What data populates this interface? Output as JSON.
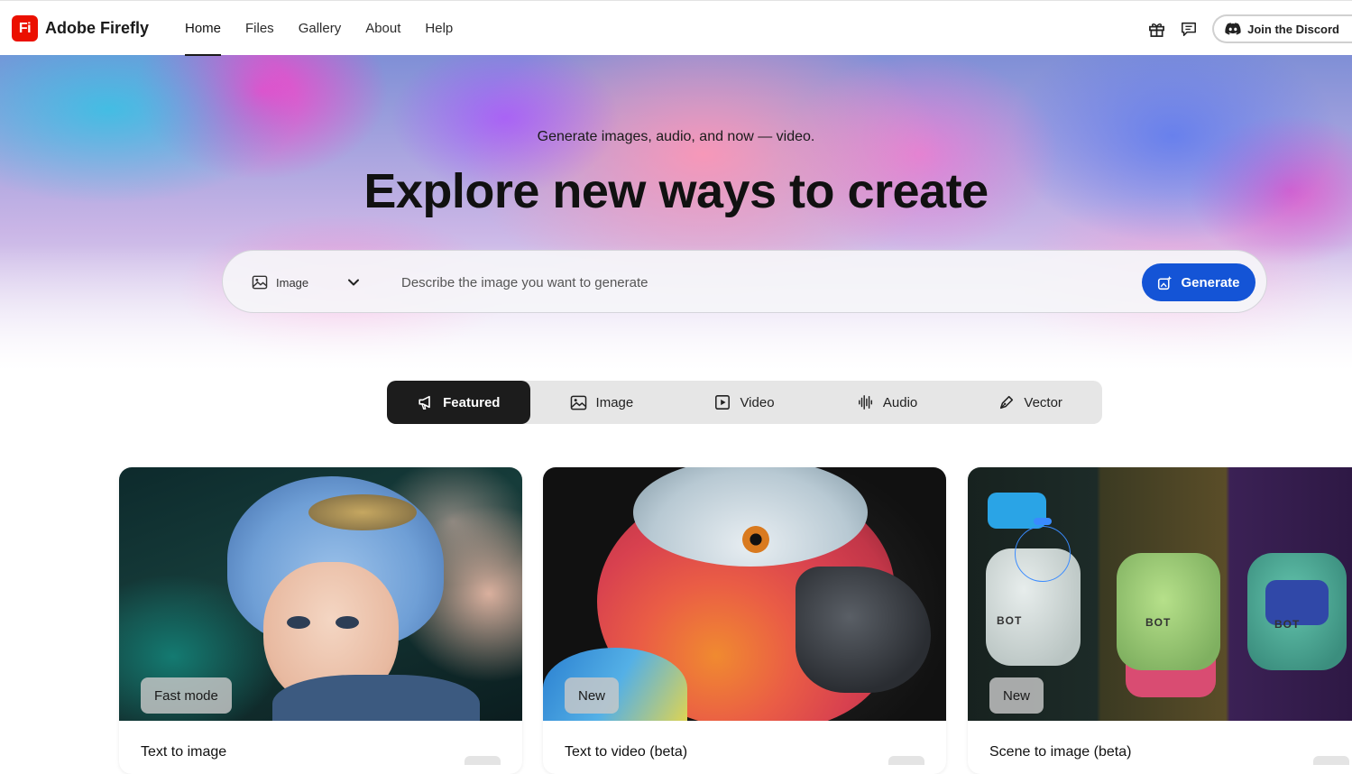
{
  "app": {
    "logo_mark": "Fi",
    "name": "Adobe Firefly"
  },
  "nav": {
    "items": [
      {
        "label": "Home",
        "active": true
      },
      {
        "label": "Files",
        "active": false
      },
      {
        "label": "Gallery",
        "active": false
      },
      {
        "label": "About",
        "active": false
      },
      {
        "label": "Help",
        "active": false
      }
    ]
  },
  "header_actions": {
    "gift_icon": "gift-icon",
    "feedback_icon": "chat-icon",
    "discord_label": "Join the Discord"
  },
  "hero": {
    "subtitle": "Generate images, audio, and now — video.",
    "title": "Explore new ways to create"
  },
  "prompt": {
    "type_value": "Image",
    "placeholder": "Describe the image you want to generate",
    "value": "",
    "generate_label": "Generate"
  },
  "tabs": [
    {
      "label": "Featured",
      "icon": "megaphone-icon",
      "active": true
    },
    {
      "label": "Image",
      "icon": "image-icon",
      "active": false
    },
    {
      "label": "Video",
      "icon": "video-icon",
      "active": false
    },
    {
      "label": "Audio",
      "icon": "waveform-icon",
      "active": false
    },
    {
      "label": "Vector",
      "icon": "pen-icon",
      "active": false
    }
  ],
  "cards": [
    {
      "title": "Text to image",
      "badge": "Fast mode"
    },
    {
      "title": "Text to video (beta)",
      "badge": "New"
    },
    {
      "title": "Scene to image (beta)",
      "badge": "New"
    }
  ],
  "colors": {
    "brand_red": "#eb1000",
    "generate_blue": "#1454d6",
    "active_tab": "#1c1c1c"
  }
}
